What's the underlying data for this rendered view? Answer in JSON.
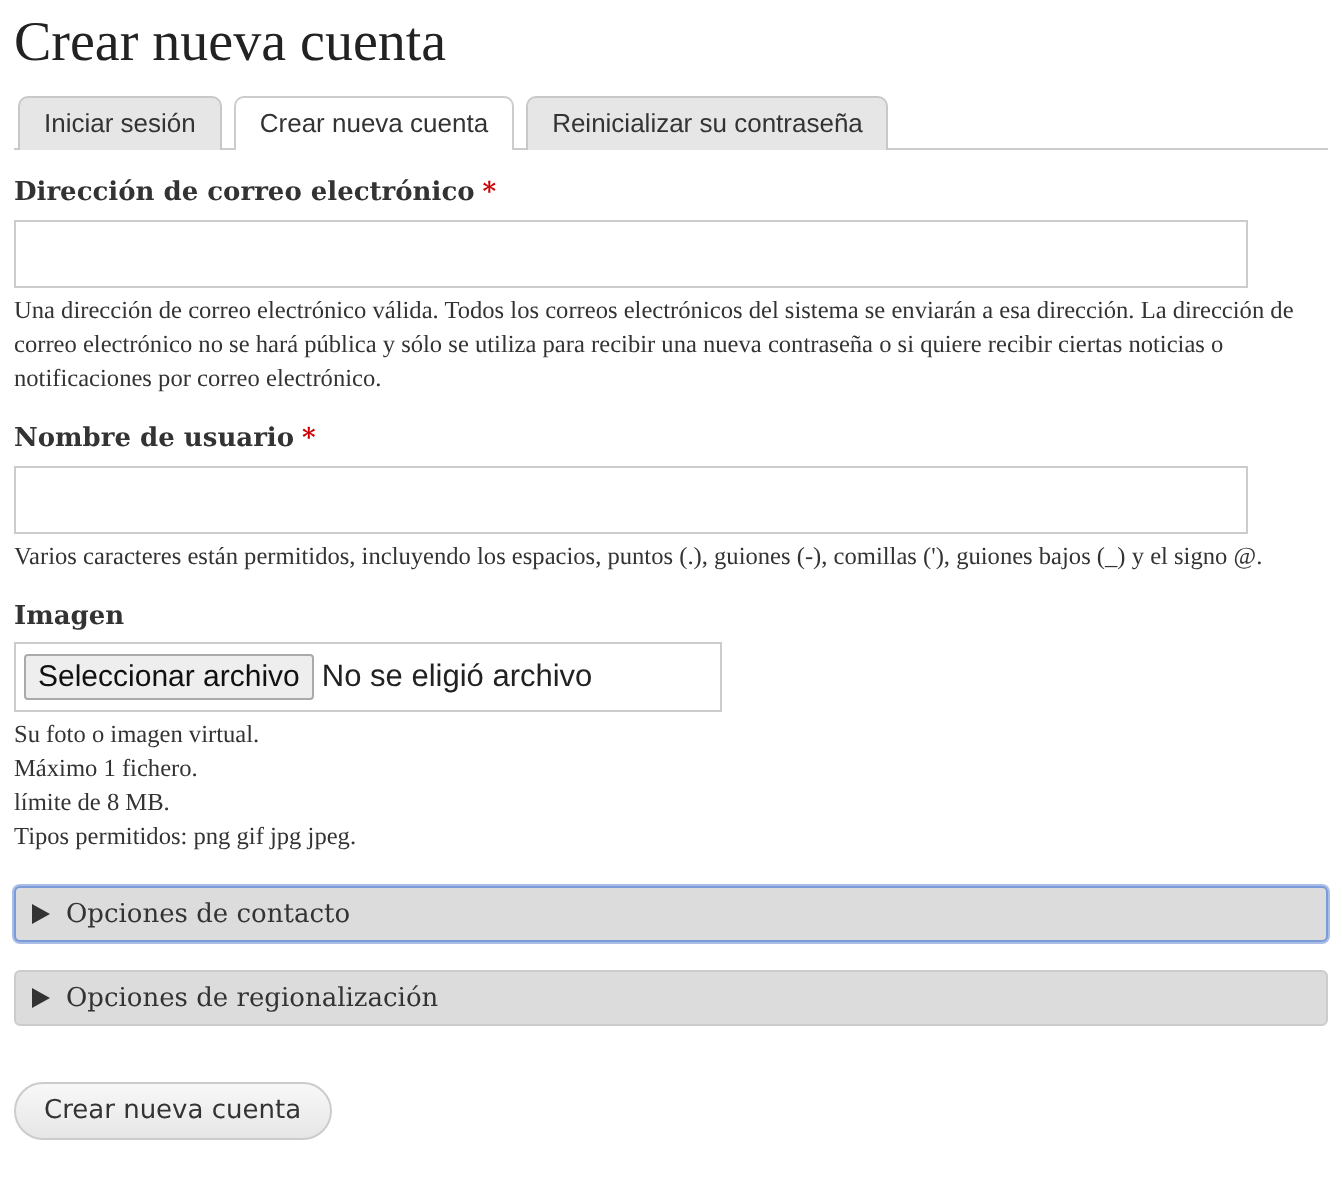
{
  "page_title": "Crear nueva cuenta",
  "tabs": [
    {
      "label": "Iniciar sesión",
      "selected": false
    },
    {
      "label": "Crear nueva cuenta",
      "selected": true
    },
    {
      "label": "Reinicializar su contraseña",
      "selected": false
    }
  ],
  "fields": [
    {
      "kind": "text",
      "label": "Dirección de correo electrónico",
      "required_mark": "*",
      "description": [
        "Una dirección de correo electrónico válida. Todos los correos electrónicos del sistema se enviarán a esa dirección. La dirección de correo electrónico no se hará pública y sólo se utiliza para recibir una nueva contraseña o si quiere recibir ciertas noticias o notificaciones por correo electrónico."
      ]
    },
    {
      "kind": "text",
      "label": "Nombre de usuario",
      "required_mark": "*",
      "description": [
        "Varios caracteres están permitidos, incluyendo los espacios, puntos (.), guiones (-), comillas ('), guiones bajos (_) y el signo @."
      ]
    },
    {
      "kind": "file",
      "label": "Imagen",
      "button": "Seleccionar archivo",
      "status": "No se eligió archivo",
      "description": [
        "Su foto o imagen virtual.",
        "Máximo 1 fichero.",
        "límite de 8 MB.",
        "Tipos permitidos: png gif jpg jpeg."
      ]
    }
  ],
  "sections": [
    {
      "label": "Opciones de contacto",
      "expanded": false,
      "focused": true
    },
    {
      "label": "Opciones de regionalización",
      "expanded": false,
      "focused": false
    }
  ],
  "submit_button": "Crear nueva cuenta"
}
